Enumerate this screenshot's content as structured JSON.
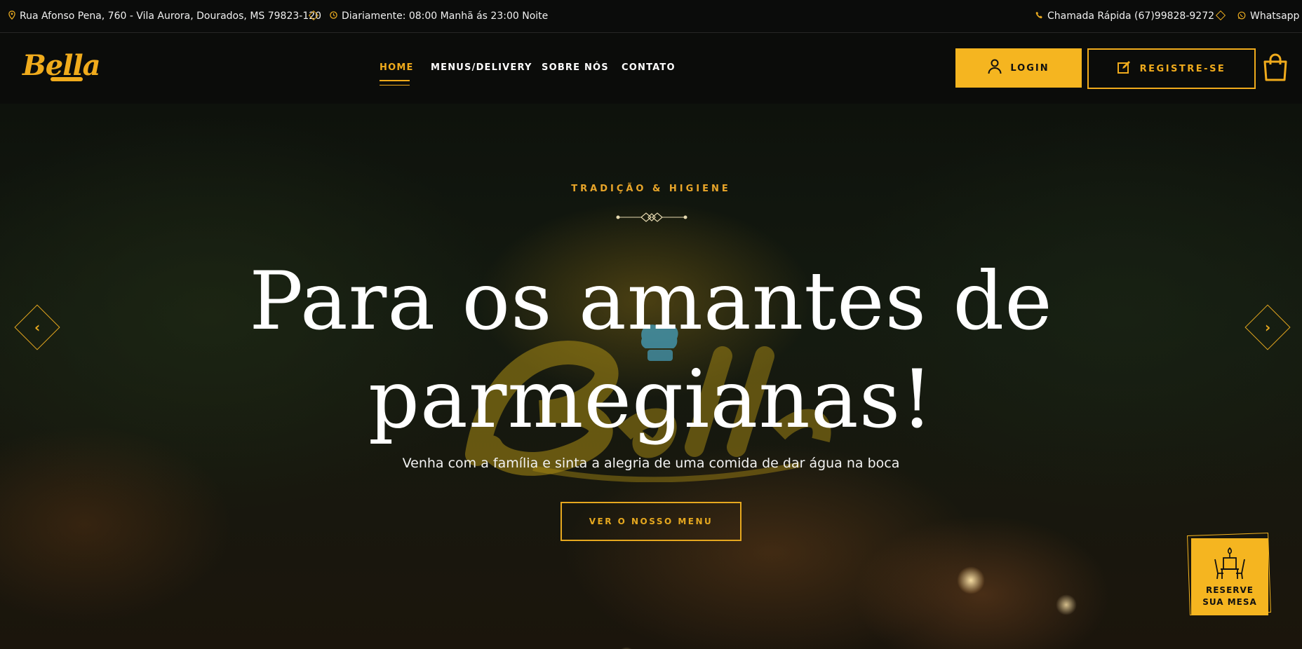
{
  "topbar": {
    "address": "Rua Afonso Pena, 760 - Vila Aurora, Dourados, MS 79823-120",
    "hours": "Diariamente: 08:00 Manhã ás 23:00 Noite",
    "phone": "Chamada Rápida (67)99828-9272",
    "whatsapp": "Whatsapp"
  },
  "header": {
    "logo": "Bella",
    "nav": [
      {
        "label": "HOME",
        "active": true
      },
      {
        "label": "MENUS/DELIVERY",
        "active": false
      },
      {
        "label": "SOBRE NÓS",
        "active": false
      },
      {
        "label": "CONTATO",
        "active": false
      }
    ],
    "login_label": "LOGIN",
    "register_label": "REGISTRE-SE"
  },
  "hero": {
    "kicker": "TRADIÇÃO & HIGIENE",
    "headline_line1": "Para os amantes de",
    "headline_line2": "parmegianas!",
    "subline": "Venha com a família e sinta a alegria de uma comida de dar água na boca",
    "cta_label": "VER O NOSSO MENU"
  },
  "reserve": {
    "line1": "RESERVE",
    "line2": "SUA MESA"
  },
  "colors": {
    "accent": "#f5b520",
    "background": "#0b0c0a"
  },
  "icons": [
    "map-pin-icon",
    "clock-icon",
    "phone-icon",
    "whatsapp-icon",
    "user-icon",
    "edit-icon",
    "shopping-bag-icon",
    "chevron-left-icon",
    "chevron-right-icon",
    "dining-table-icon"
  ]
}
